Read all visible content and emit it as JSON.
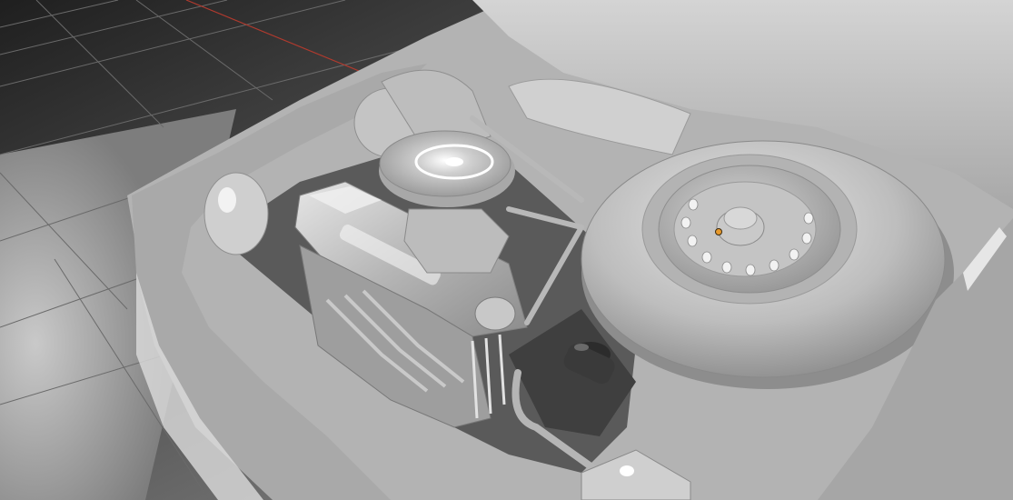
{
  "app": {
    "view": "3d-viewport",
    "shading": "solid-matcap"
  },
  "scene": {
    "subject": "car-engine-bay",
    "objects": [
      {
        "name": "engine-block-icon"
      },
      {
        "name": "air-filter-icon"
      },
      {
        "name": "spare-tire-icon"
      },
      {
        "name": "wheel-rim-icon"
      },
      {
        "name": "origin-point-icon"
      }
    ]
  },
  "colors": {
    "background_dark": "#2e2e2e",
    "floor": "#9a9a9a",
    "grid_line": "#6f6f6f",
    "axis_x": "#c0392b",
    "axis_y": "#3c8c3c",
    "body": "#bdbdbd",
    "body_light": "#d9d9d9",
    "body_shadow": "#7a7a7a",
    "origin": "#e89a2c"
  }
}
